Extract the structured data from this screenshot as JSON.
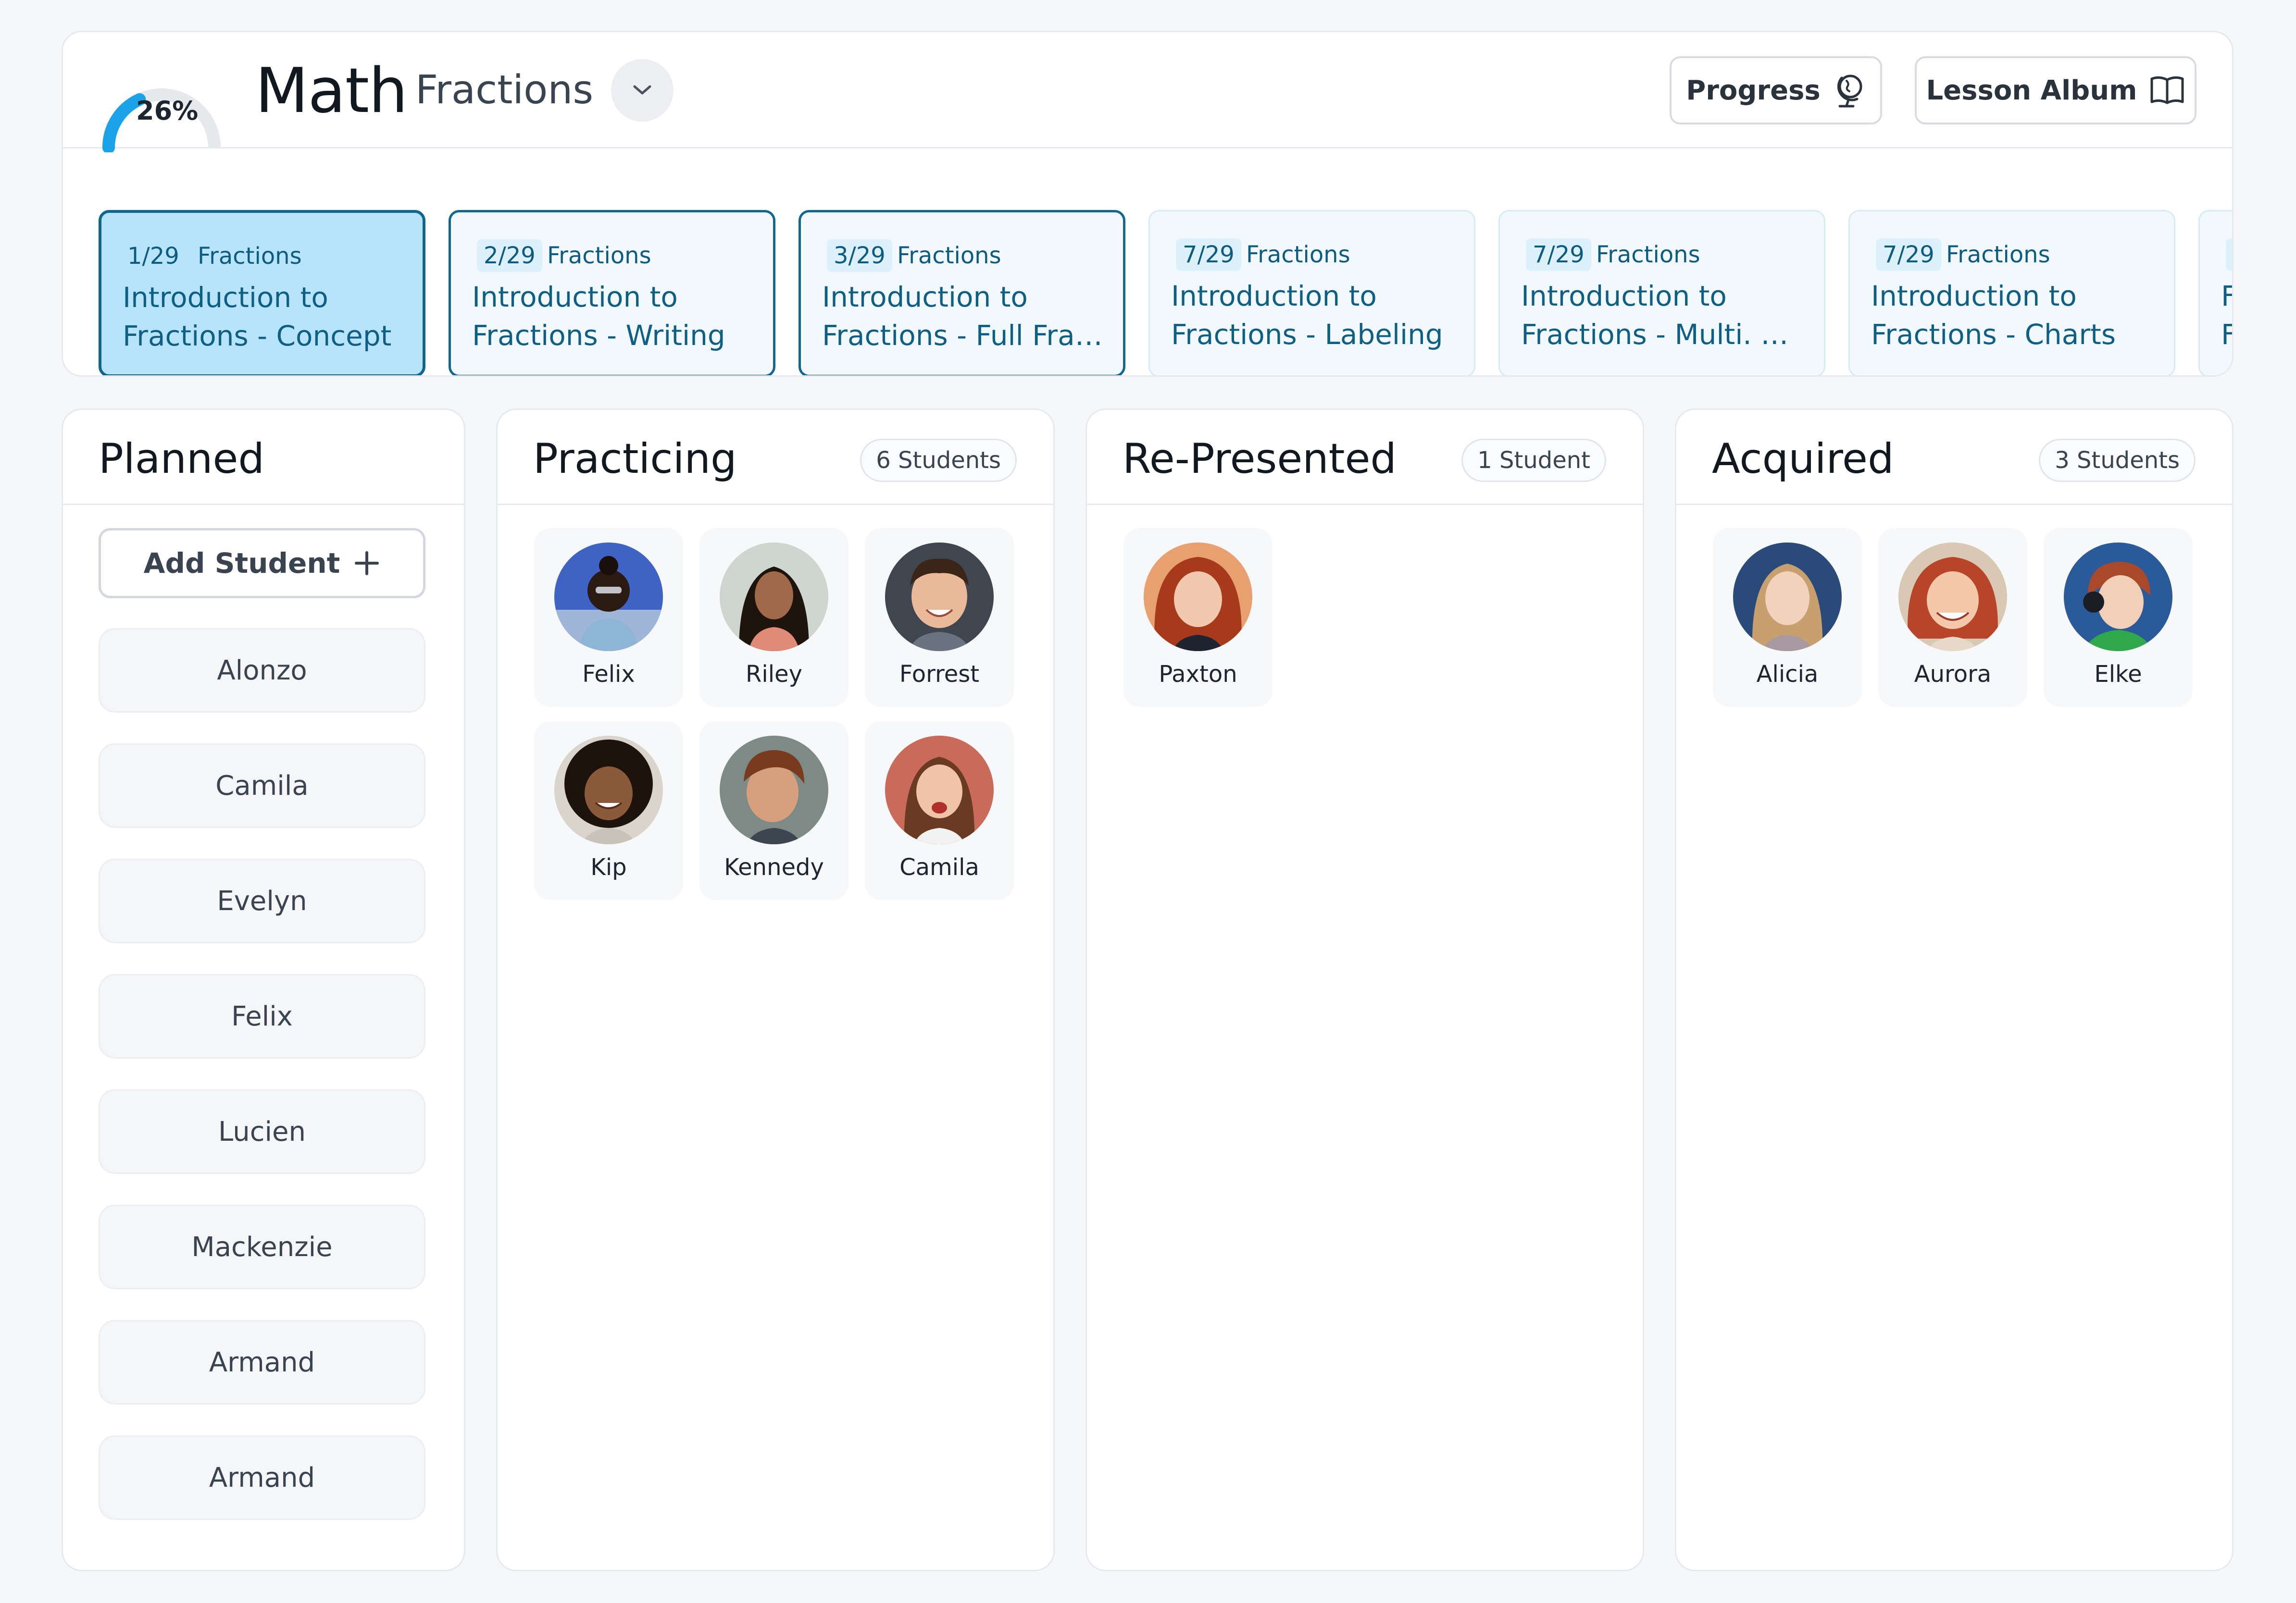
{
  "header": {
    "progress_percent": 26,
    "progress_label": "26%",
    "subject": "Math",
    "lesson": "Fractions",
    "progress_button": "Progress",
    "album_button": "Lesson Album"
  },
  "lessons": [
    {
      "date": "1/29",
      "subject": "Fractions",
      "title_line1": "Introduction to",
      "title_line2": "Fractions - Concept"
    },
    {
      "date": "2/29",
      "subject": "Fractions",
      "title_line1": "Introduction to",
      "title_line2": "Fractions - Writing"
    },
    {
      "date": "3/29",
      "subject": "Fractions",
      "title_line1": "Introduction to",
      "title_line2": "Fractions - Full Fracti..."
    },
    {
      "date": "7/29",
      "subject": "Fractions",
      "title_line1": "Introduction to",
      "title_line2": "Fractions - Labeling"
    },
    {
      "date": "7/29",
      "subject": "Fractions",
      "title_line1": "Introduction to",
      "title_line2": "Fractions - Multi. Seg..."
    },
    {
      "date": "7/29",
      "subject": "Fractions",
      "title_line1": "Introduction to",
      "title_line2": "Fractions - Charts"
    },
    {
      "date": "7",
      "subject": "",
      "title_line1": "F",
      "title_line2": "F"
    }
  ],
  "columns": {
    "planned": {
      "title": "Planned",
      "add_label": "Add Student",
      "students": [
        "Alonzo",
        "Camila",
        "Evelyn",
        "Felix",
        "Lucien",
        "Mackenzie",
        "Armand",
        "Armand"
      ]
    },
    "practicing": {
      "title": "Practicing",
      "count": "6 Students",
      "students": [
        "Felix",
        "Riley",
        "Forrest",
        "Kip",
        "Kennedy",
        "Camila"
      ]
    },
    "represented": {
      "title": "Re-Presented",
      "count": "1 Student",
      "students": [
        "Paxton"
      ]
    },
    "acquired": {
      "title": "Acquired",
      "count": "3 Students",
      "students": [
        "Alicia",
        "Aurora",
        "Elke"
      ]
    }
  },
  "colors": {
    "accent": "#1aa3e8",
    "selected_tile": "#b8e4fb",
    "tile_border": "#0f668f"
  }
}
